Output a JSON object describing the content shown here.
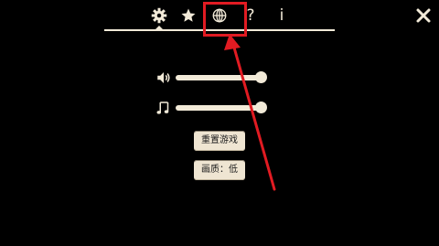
{
  "tabs": {
    "items": [
      {
        "id": "settings",
        "icon": "gear-icon",
        "active": true
      },
      {
        "id": "favorites",
        "icon": "star-icon",
        "active": false
      },
      {
        "id": "language",
        "icon": "globe-icon",
        "active": false
      },
      {
        "id": "help",
        "icon": "question-mark-icon",
        "label": "?",
        "active": false
      },
      {
        "id": "info",
        "icon": "info-icon",
        "label": "i",
        "active": false
      }
    ]
  },
  "close_icon": "close-icon",
  "sliders": {
    "volume": {
      "icon": "speaker-icon",
      "level": 1.0
    },
    "music": {
      "icon": "music-note-icon",
      "level": 1.0
    }
  },
  "buttons": {
    "reset_label": "重置游戏",
    "quality_label": "画质：低"
  },
  "annotation": {
    "color": "#e11b22",
    "highlight_target": "language"
  },
  "colors": {
    "background": "#000000",
    "foreground": "#f2ead8",
    "button_bg": "#efe5d2"
  }
}
